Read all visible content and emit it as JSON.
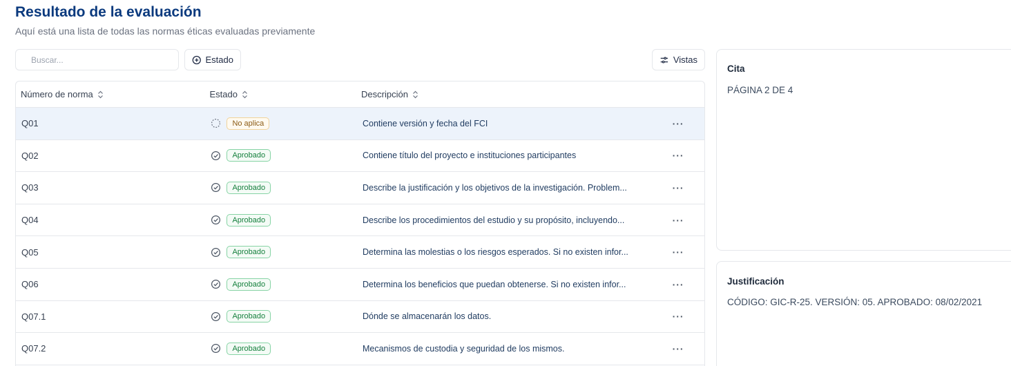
{
  "header": {
    "title": "Resultado de la evaluación",
    "subtitle": "Aquí está una lista de todas las normas éticas evaluadas previamente"
  },
  "toolbar": {
    "search_placeholder": "Buscar...",
    "estado_label": "Estado",
    "vistas_label": "Vistas"
  },
  "table": {
    "columns": [
      "Número de norma",
      "Estado",
      "Descripción"
    ],
    "rows": [
      {
        "id": "Q01",
        "status": "No aplica",
        "status_kind": "pending",
        "description": "Contiene versión y fecha del FCI"
      },
      {
        "id": "Q02",
        "status": "Aprobado",
        "status_kind": "approved",
        "description": "Contiene título del proyecto e instituciones participantes"
      },
      {
        "id": "Q03",
        "status": "Aprobado",
        "status_kind": "approved",
        "description": "Describe la justificación y los objetivos de la investigación. Problem..."
      },
      {
        "id": "Q04",
        "status": "Aprobado",
        "status_kind": "approved",
        "description": "Describe los procedimientos del estudio y su propósito, incluyendo..."
      },
      {
        "id": "Q05",
        "status": "Aprobado",
        "status_kind": "approved",
        "description": "Determina las molestias o los riesgos esperados. Si no existen infor..."
      },
      {
        "id": "Q06",
        "status": "Aprobado",
        "status_kind": "approved",
        "description": "Determina los beneficios que puedan obtenerse. Si no existen infor..."
      },
      {
        "id": "Q07.1",
        "status": "Aprobado",
        "status_kind": "approved",
        "description": "Dónde se almacenarán los datos."
      },
      {
        "id": "Q07.2",
        "status": "Aprobado",
        "status_kind": "approved",
        "description": "Mecanismos de custodia y seguridad de los mismos."
      }
    ],
    "row_menu": "···"
  },
  "panels": {
    "cita": {
      "title": "Cita",
      "text": "PÁGINA 2 DE 4"
    },
    "justificacion": {
      "title": "Justificación",
      "text": "CÓDIGO: GIC-R-25. VERSIÓN: 05. APROBADO: 08/02/2021"
    }
  },
  "icons": {
    "estado_button": "plus-circle-icon",
    "vistas_button": "sliders-icon",
    "sort": "sort-icon",
    "approved": "check-circle-icon",
    "pending": "dashed-circle-icon",
    "row_menu": "more-horizontal-icon"
  },
  "colors": {
    "title": "#0b3a7e",
    "approved_text": "#15803d",
    "approved_border": "#86d3a4",
    "pending_text": "#8a5a13",
    "pending_border": "#f1d39a",
    "row_highlight": "#edf3fb"
  }
}
